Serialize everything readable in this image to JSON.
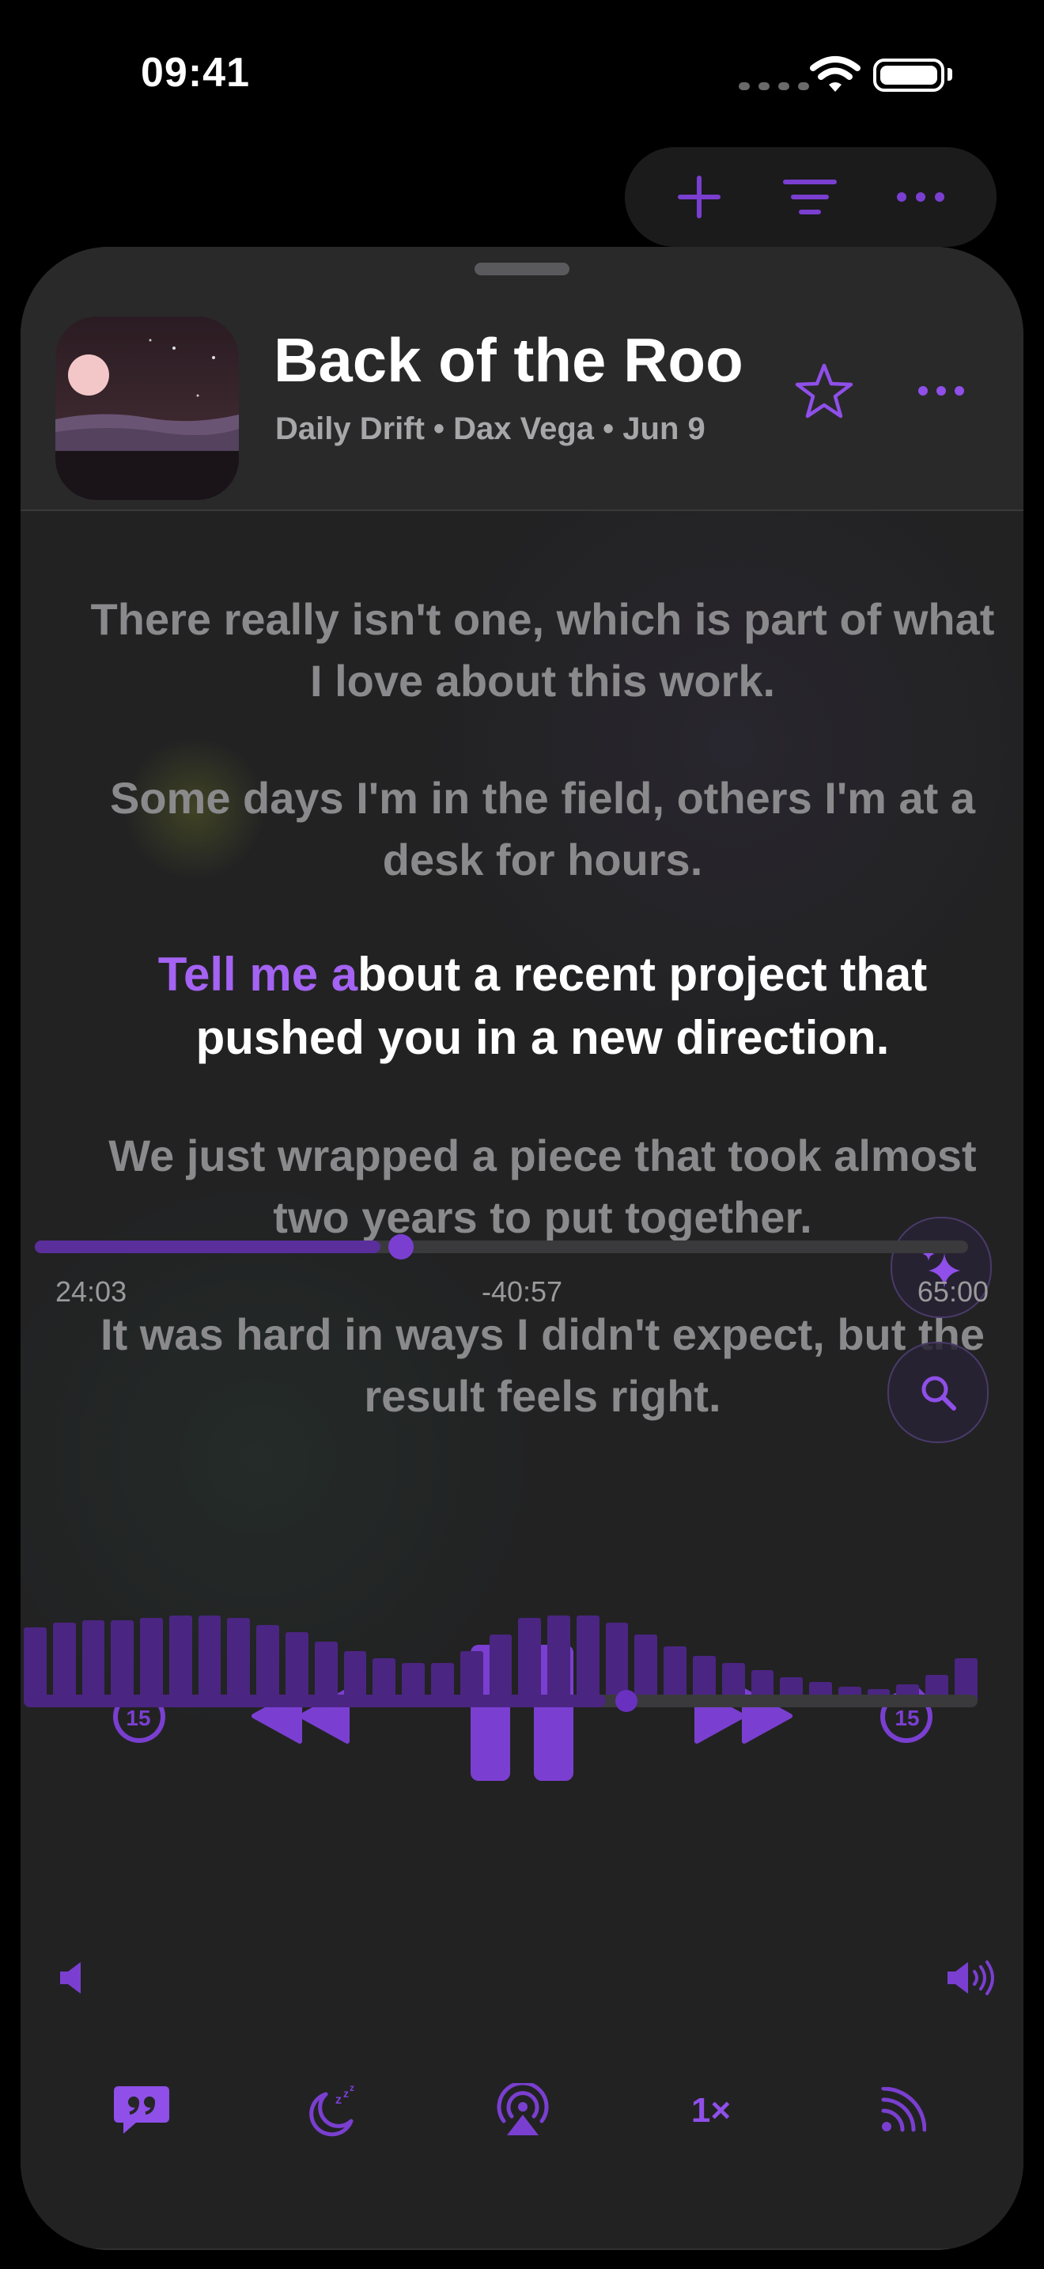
{
  "status": {
    "time": "09:41"
  },
  "toolbar": {
    "icons": [
      "plus-icon",
      "filter-icon",
      "more-icon"
    ]
  },
  "episode": {
    "title": "Back of the Roo",
    "subtitle": "Daily Drift • Dax Vega • Jun 9"
  },
  "transcript": {
    "lines": [
      "There really isn't one, which is part of what I love about this work.",
      "Some days I'm in the field, others I'm at a desk for hours.",
      "We just wrapped a piece that took almost two years to put together.",
      "It was hard in ways I didn't expect, but the result feels right."
    ],
    "active_spoken": "Tell me a",
    "active_rest": "bout a recent project that pushed you in a new direction."
  },
  "playback": {
    "elapsed": "24:03",
    "remaining": "-40:57",
    "duration": "65:00",
    "progress_fraction": 0.37,
    "state": "playing",
    "skip_back_seconds": "15",
    "skip_forward_seconds": "15"
  },
  "volume": {
    "level_fraction": 0.61,
    "visualizer_levels": [
      0.62,
      0.66,
      0.68,
      0.68,
      0.7,
      0.72,
      0.72,
      0.7,
      0.64,
      0.58,
      0.5,
      0.42,
      0.36,
      0.32,
      0.32,
      0.42,
      0.56,
      0.7,
      0.72,
      0.72,
      0.66,
      0.56,
      0.46,
      0.38,
      0.32,
      0.26,
      0.2,
      0.16,
      0.12,
      0.1,
      0.14,
      0.22,
      0.36
    ]
  },
  "bottom_bar": {
    "speed_label": "1×"
  },
  "colors": {
    "accent": "#a463f2",
    "sheet": "#262627",
    "muted_text": "#8a8a8c"
  }
}
